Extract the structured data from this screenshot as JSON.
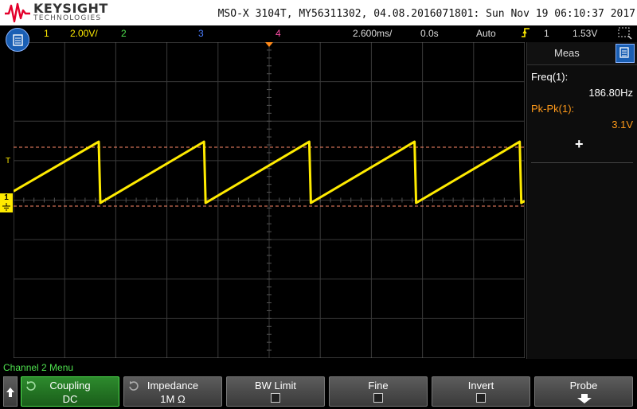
{
  "header": {
    "brand": "KEYSIGHT",
    "brand_sub": "TECHNOLOGIES",
    "instrument": "MSO-X 3104T, MY56311302, 04.08.2016071801: Sun Nov 19 06:10:37 2017"
  },
  "status_bar": {
    "ch1_num": "1",
    "ch1_scale": "2.00V/",
    "ch2_num": "2",
    "ch3_num": "3",
    "ch4_num": "4",
    "timebase": "2.600ms/",
    "delay": "0.0s",
    "trigger_mode": "Auto",
    "trigger_icon": "rising-edge-trigger",
    "trigger_source": "1",
    "trigger_level": "1.53V"
  },
  "markers": {
    "trigger_level_marker": "T",
    "ch1_ground_marker": "1"
  },
  "measurements": {
    "title": "Meas",
    "items": [
      {
        "label": "Freq(1):",
        "value": "186.80Hz",
        "color": "#ffffff"
      },
      {
        "label": "Pk-Pk(1):",
        "value": "3.1V",
        "color": "#ff9a1a"
      }
    ],
    "add_label": "+"
  },
  "softkeys": {
    "menu_title": "Channel 2 Menu",
    "back_icon": "up-arrow-icon",
    "keys": [
      {
        "label": "Coupling",
        "value": "DC"
      },
      {
        "label": "Impedance",
        "value": "1M Ω"
      },
      {
        "label": "BW Limit",
        "checked": false
      },
      {
        "label": "Fine",
        "checked": false
      },
      {
        "label": "Invert",
        "checked": false
      },
      {
        "label": "Probe",
        "icon": "down-arrow-icon"
      }
    ]
  },
  "colors": {
    "ch1": "#ffeb00",
    "ch2": "#4ee04e",
    "ch3": "#4a7dff",
    "ch4": "#ff4fa8",
    "accent": "#1a5fb4",
    "cursor": "#ff8a6a"
  },
  "waveform": {
    "channel": "1",
    "shape": "sawtooth",
    "frequency_hz": 186.8,
    "volts_per_div": 2.0,
    "time_per_div_ms": 2.6,
    "peak_to_peak_v": 3.1
  }
}
